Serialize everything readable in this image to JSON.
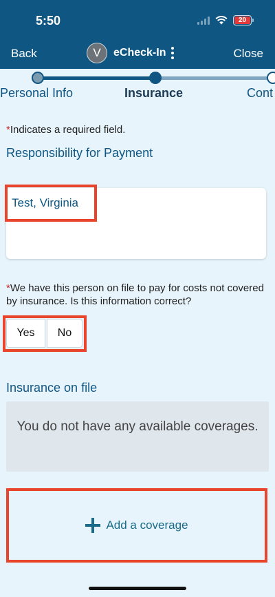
{
  "status_bar": {
    "time": "5:50",
    "battery": "20"
  },
  "nav": {
    "back_label": "Back",
    "avatar_initial": "V",
    "title": "eCheck-In",
    "close_label": "Close"
  },
  "steps": {
    "previous": "Personal Info",
    "current": "Insurance",
    "next": "Cont"
  },
  "required_note": {
    "marker": "*",
    "text": "Indicates a required field."
  },
  "payment": {
    "section_label": "Responsibility for Payment",
    "payer_name": "Test, Virginia"
  },
  "question": {
    "marker": "*",
    "text": "We have this person on file to pay for costs not covered by insurance. Is this information correct?"
  },
  "answers": {
    "yes_label": "Yes",
    "no_label": "No"
  },
  "insurance": {
    "section_label": "Insurance on file",
    "empty_message": "You do not have any available coverages.",
    "add_label": "Add a coverage"
  },
  "colors": {
    "header": "#0f5683",
    "highlight": "#e8452c",
    "background": "#e8f4fb"
  }
}
